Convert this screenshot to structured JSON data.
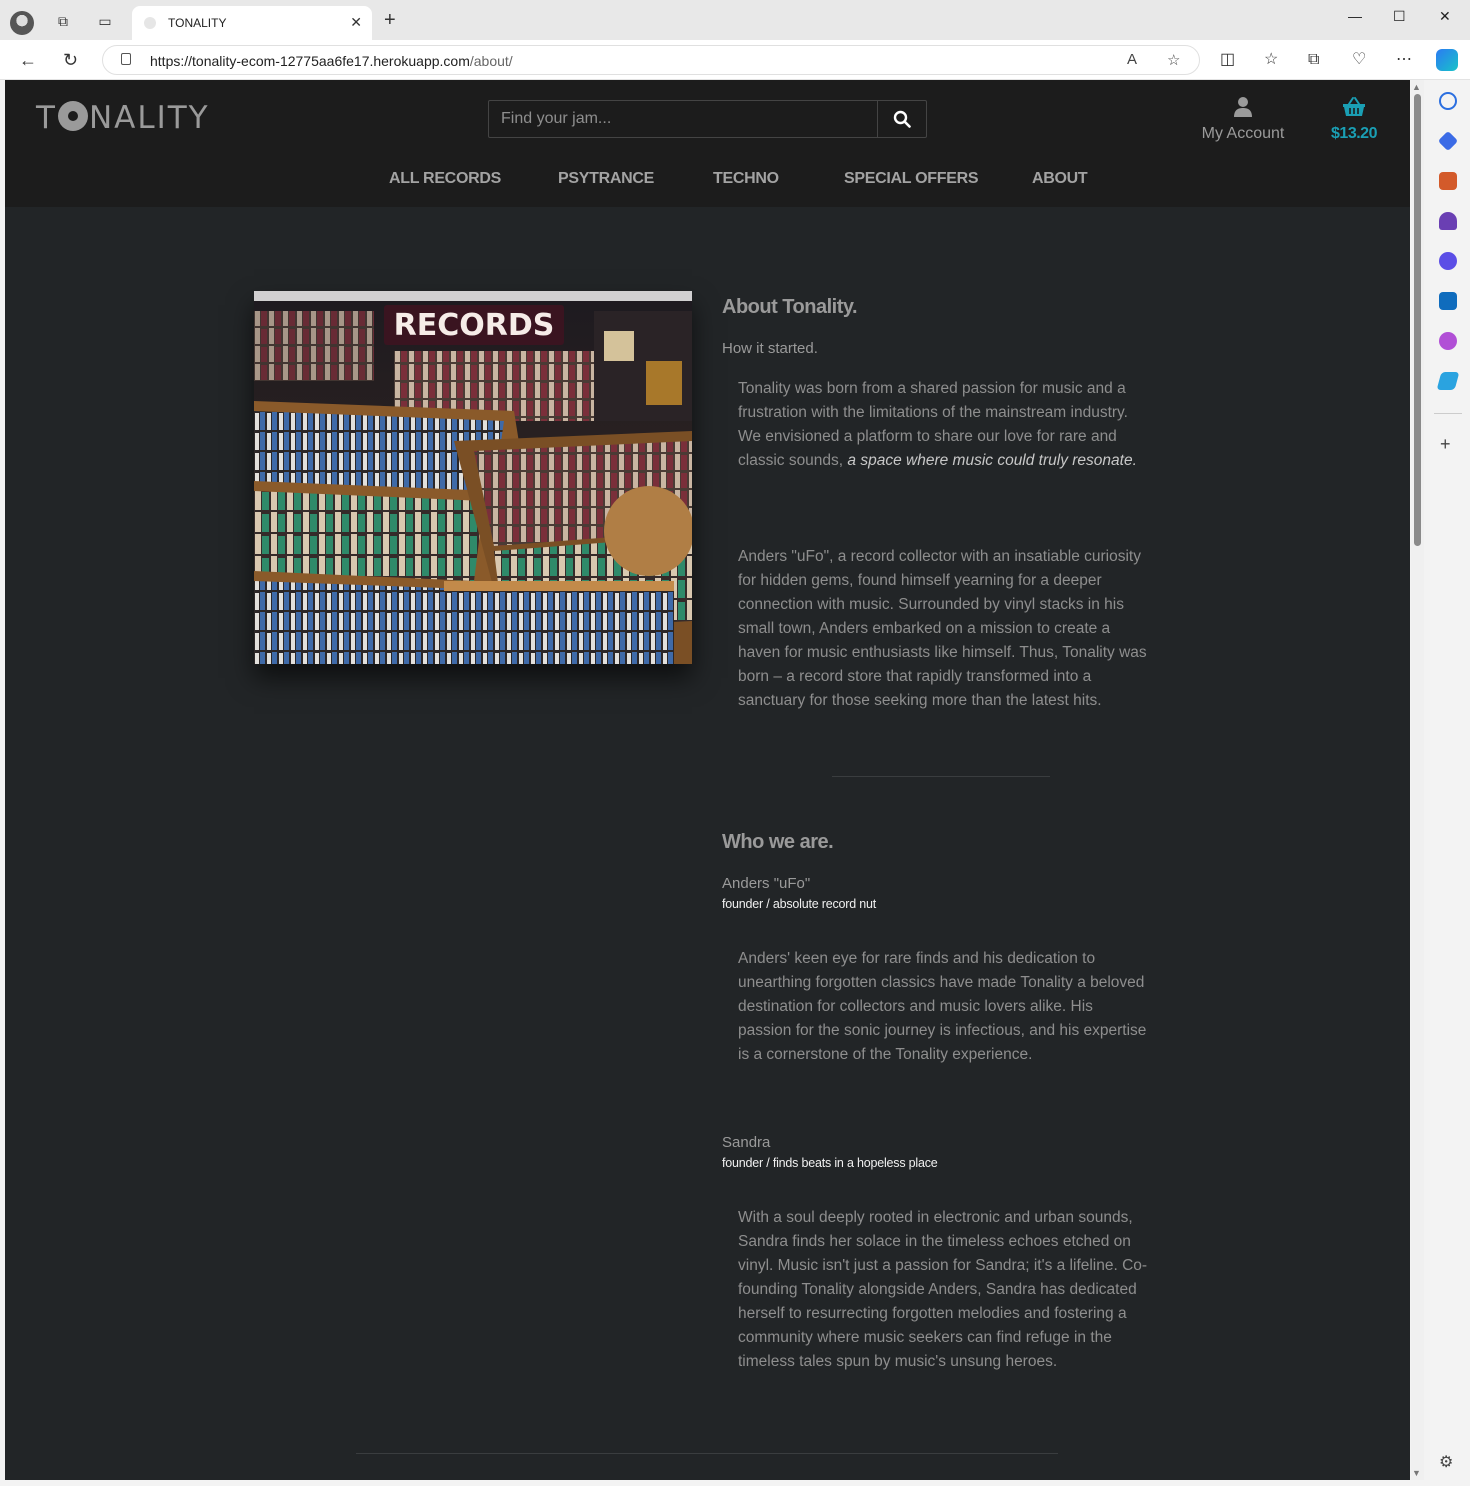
{
  "browser": {
    "tab_title": "TONALITY",
    "url_host": "https://tonality-ecom-12775aa6fe17.herokuapp.com",
    "url_path": "/about/"
  },
  "site": {
    "logo": {
      "pre": "T",
      "post": "NALITY"
    },
    "search_placeholder": "Find your jam...",
    "account_label": "My Account",
    "cart_total": "$13.20",
    "nav": [
      "ALL RECORDS",
      "PSYTRANCE",
      "TECHNO",
      "SPECIAL OFFERS",
      "ABOUT"
    ]
  },
  "about": {
    "heading": "About Tonality.",
    "subheading": "How it started.",
    "para1": "Tonality was born from a shared passion for music and a frustration with the limitations of the mainstream industry. We envisioned a platform to share our love for rare and classic sounds,",
    "para1_em": "a space where music could truly resonate.",
    "para2": "Anders \"uFo\", a record collector with an insatiable curiosity for hidden gems, found himself yearning for a deeper connection with music. Surrounded by vinyl stacks in his small town, Anders embarked on a mission to create a haven for music enthusiasts like himself. Thus, Tonality was born – a record store that rapidly transformed into a sanctuary for those seeking more than the latest hits."
  },
  "team": {
    "heading": "Who we are.",
    "members": [
      {
        "name": "Anders \"uFo\"",
        "role": "founder / absolute record nut",
        "bio": "Anders' keen eye for rare finds and his dedication to unearthing forgotten classics have made Tonality a beloved destination for collectors and music lovers alike. His passion for the sonic journey is infectious, and his expertise is a cornerstone of the Tonality experience."
      },
      {
        "name": "Sandra",
        "role": "founder / finds beats in a hopeless place",
        "bio": "With a soul deeply rooted in electronic and urban sounds, Sandra finds her solace in the timeless echoes etched on vinyl. Music isn't just a passion for Sandra; it's a lifeline. Co-founding Tonality alongside Anders, Sandra has dedicated herself to resurrecting forgotten melodies and fostering a community where music seekers can find refuge in the timeless tales spun by music's unsung heroes."
      }
    ]
  },
  "image_sign": "RECORDS",
  "colors": {
    "page_bg": "#222527",
    "header_bg": "#1c1c1c",
    "accent": "#1a9fb4",
    "text": "#9a9a9a"
  }
}
